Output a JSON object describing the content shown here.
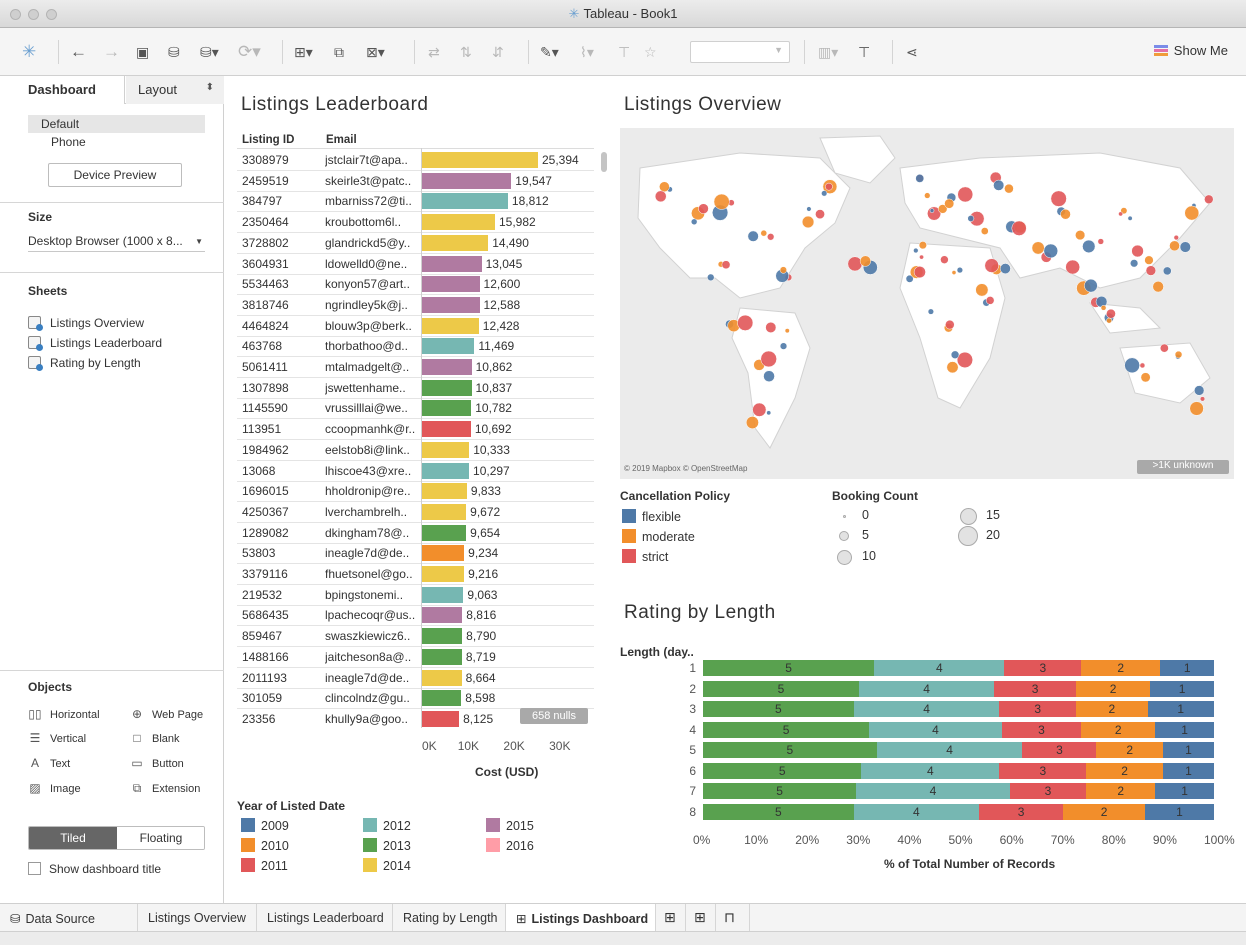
{
  "window": {
    "title": "Tableau - Book1"
  },
  "toolbar": {
    "show_me_label": "Show Me"
  },
  "sidebar": {
    "tabs": {
      "dashboard": "Dashboard",
      "layout": "Layout"
    },
    "devices": [
      "Default",
      "Phone"
    ],
    "device_preview_label": "Device Preview",
    "size_heading": "Size",
    "size_value": "Desktop Browser (1000 x 8...",
    "sheets_heading": "Sheets",
    "sheets": [
      "Listings Overview",
      "Listings Leaderboard",
      "Rating by Length"
    ],
    "objects_heading": "Objects",
    "objects": [
      {
        "label": "Horizontal",
        "icon": "horizontal-container-icon"
      },
      {
        "label": "Web Page",
        "icon": "web-page-icon"
      },
      {
        "label": "Vertical",
        "icon": "vertical-container-icon"
      },
      {
        "label": "Blank",
        "icon": "blank-icon"
      },
      {
        "label": "Text",
        "icon": "text-icon"
      },
      {
        "label": "Button",
        "icon": "button-icon"
      },
      {
        "label": "Image",
        "icon": "image-icon"
      },
      {
        "label": "Extension",
        "icon": "extension-icon"
      }
    ],
    "tiled_label": "Tiled",
    "floating_label": "Floating",
    "show_title_label": "Show dashboard title"
  },
  "leaderboard": {
    "title": "Listings Leaderboard",
    "headers": {
      "id": "Listing ID",
      "email": "Email"
    },
    "nulls_badge": "658 nulls",
    "x_label": "Cost (USD)",
    "x_ticks": [
      "0K",
      "10K",
      "20K",
      "30K"
    ],
    "legend_title": "Year of Listed Date"
  },
  "map": {
    "title": "Listings Overview",
    "attribution": "© 2019 Mapbox © OpenStreetMap",
    "unknown_badge": ">1K unknown",
    "cancellation_title": "Cancellation Policy",
    "cancellation": [
      {
        "label": "flexible",
        "color": "#4e79a7"
      },
      {
        "label": "moderate",
        "color": "#f28e2b"
      },
      {
        "label": "strict",
        "color": "#e15759"
      }
    ],
    "booking_title": "Booking Count",
    "booking_sizes": [
      "0",
      "5",
      "10",
      "15",
      "20"
    ]
  },
  "rating": {
    "title": "Rating by Length",
    "y_label": "Length (day..",
    "x_label": "% of Total Number of Records",
    "x_ticks": [
      "0%",
      "10%",
      "20%",
      "30%",
      "40%",
      "50%",
      "60%",
      "70%",
      "80%",
      "90%",
      "100%"
    ]
  },
  "bottom_tabs": [
    "Data Source",
    "Listings Overview",
    "Listings Leaderboard",
    "Rating by Length",
    "Listings Dashboard"
  ],
  "chart_data": [
    {
      "type": "bar",
      "title": "Listings Leaderboard",
      "xlabel": "Cost (USD)",
      "xlim": [
        0,
        30000
      ],
      "orientation": "horizontal",
      "columns": [
        "Listing ID",
        "Email",
        "Cost (USD)",
        "Year of Listed Date"
      ],
      "rows": [
        [
          "3308979",
          "jstclair7t@apa..",
          25394,
          "2014"
        ],
        [
          "2459519",
          "skeirle3t@patc..",
          19547,
          "2015"
        ],
        [
          "384797",
          "mbarniss72@ti..",
          18812,
          "2012"
        ],
        [
          "2350464",
          "kroubottom6l..",
          15982,
          "2014"
        ],
        [
          "3728802",
          "glandrickd5@y..",
          14490,
          "2014"
        ],
        [
          "3604931",
          "ldowelld0@ne..",
          13045,
          "2015"
        ],
        [
          "5534463",
          "konyon57@art..",
          12600,
          "2015"
        ],
        [
          "3818746",
          "ngrindley5k@j..",
          12588,
          "2015"
        ],
        [
          "4464824",
          "blouw3p@berk..",
          12428,
          "2014"
        ],
        [
          "463768",
          "thorbathoo@d..",
          11469,
          "2012"
        ],
        [
          "5061411",
          "mtalmadgelt@..",
          10862,
          "2015"
        ],
        [
          "1307898",
          "jswettenhame..",
          10837,
          "2013"
        ],
        [
          "1145590",
          "vrussilllai@we..",
          10782,
          "2013"
        ],
        [
          "113951",
          "ccoopmanhk@r..",
          10692,
          "2011"
        ],
        [
          "1984962",
          "eelstob8i@link..",
          10333,
          "2014"
        ],
        [
          "13068",
          "lhiscoe43@xre..",
          10297,
          "2012"
        ],
        [
          "1696015",
          "hholdronip@re..",
          9833,
          "2014"
        ],
        [
          "4250367",
          "lverchambrelh..",
          9672,
          "2014"
        ],
        [
          "1289082",
          "dkingham78@..",
          9654,
          "2013"
        ],
        [
          "53803",
          "ineagle7d@de..",
          9234,
          "2010"
        ],
        [
          "3379116",
          "fhuetsonel@go..",
          9216,
          "2014"
        ],
        [
          "219532",
          "bpingstonemi..",
          9063,
          "2012"
        ],
        [
          "5686435",
          "lpachecoqr@us..",
          8816,
          "2015"
        ],
        [
          "859467",
          "swaszkiewicz6..",
          8790,
          "2013"
        ],
        [
          "1488166",
          "jaitcheson8a@..",
          8719,
          "2013"
        ],
        [
          "2011193",
          "ineagle7d@de..",
          8664,
          "2014"
        ],
        [
          "301059",
          "clincolndz@gu..",
          8598,
          "2013"
        ],
        [
          "23356",
          "khully9a@goo..",
          8125,
          "2011"
        ]
      ],
      "legend": [
        {
          "name": "2009",
          "color": "#4e79a7"
        },
        {
          "name": "2010",
          "color": "#f28e2b"
        },
        {
          "name": "2011",
          "color": "#e15759"
        },
        {
          "name": "2012",
          "color": "#76b7b2"
        },
        {
          "name": "2013",
          "color": "#59a14f"
        },
        {
          "name": "2014",
          "color": "#edc948"
        },
        {
          "name": "2015",
          "color": "#b07aa1"
        },
        {
          "name": "2016",
          "color": "#ff9da7"
        }
      ]
    },
    {
      "type": "bar",
      "stacked": "100%",
      "title": "Rating by Length",
      "ylabel": "Length (day..",
      "xlabel": "% of Total Number of Records",
      "xlim": [
        0,
        100
      ],
      "categories": [
        "1",
        "2",
        "3",
        "4",
        "5",
        "6",
        "7",
        "8"
      ],
      "series": [
        {
          "name": "5",
          "color": "#59a14f",
          "values": [
            33.5,
            30.5,
            29.5,
            32.5,
            34.0,
            31.0,
            30.0,
            29.5
          ]
        },
        {
          "name": "4",
          "color": "#76b7b2",
          "values": [
            25.5,
            26.5,
            28.5,
            26.0,
            28.5,
            27.0,
            30.0,
            24.5
          ]
        },
        {
          "name": "3",
          "color": "#e15759",
          "values": [
            15.0,
            16.0,
            15.0,
            15.5,
            14.5,
            17.0,
            15.0,
            16.5
          ]
        },
        {
          "name": "2",
          "color": "#f28e2b",
          "values": [
            15.5,
            14.5,
            14.0,
            14.5,
            13.0,
            15.0,
            13.5,
            16.0
          ]
        },
        {
          "name": "1",
          "color": "#4e79a7",
          "values": [
            10.5,
            12.5,
            13.0,
            11.5,
            10.0,
            10.0,
            11.5,
            13.5
          ]
        }
      ]
    }
  ]
}
